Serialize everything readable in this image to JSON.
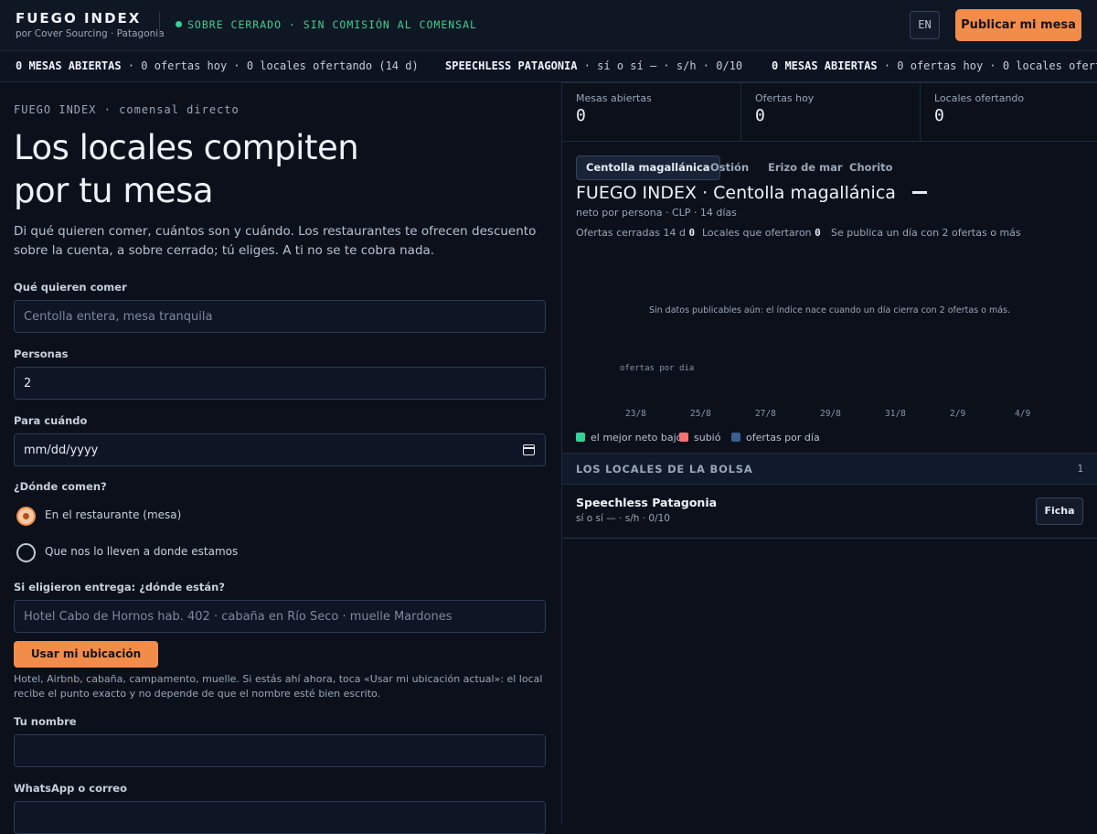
{
  "header": {
    "brand": "FUEGO INDEX",
    "brand_sub": "por Cover Sourcing · Patagonia",
    "status": "SOBRE CERRADO · SIN COMISIÓN AL COMENSAL",
    "lang_label": "EN",
    "publish_label": "Publicar mi mesa",
    "accent_color": "#f28c4a",
    "status_color": "#34d399"
  },
  "ticker": [
    {
      "bold": "0 MESAS ABIERTAS",
      "rest": " · 0 ofertas hoy · 0 locales ofertando (14 d)"
    },
    {
      "bold": "SPEECHLESS PATAGONIA",
      "rest": " · sí o sí — · s/h · 0/10"
    },
    {
      "bold": "0 MESAS ABIERTAS",
      "rest": " · 0 ofertas hoy · 0 locales ofertando (14 d)"
    }
  ],
  "form": {
    "eyebrow": "FUEGO INDEX · comensal directo",
    "hero_line1": "Los locales compiten",
    "hero_line2": "por tu mesa",
    "lead": "Di qué quieren comer, cuántos son y cuándo. Los restaurantes te ofrecen descuento sobre la cuenta, a sobre cerrado; tú eliges. A ti no se te cobra nada.",
    "what_label": "Qué quieren comer",
    "what_placeholder": "Centolla entera, mesa tranquila",
    "people_label": "Personas",
    "people_value": "2",
    "when_label": "Para cuándo",
    "when_value": "mm/dd/yyyy",
    "where_label": "¿Dónde comen?",
    "option_restaurant": "En el restaurante (mesa)",
    "option_delivery": "Que nos lo lleven a donde estamos",
    "selected_option": "En el restaurante (mesa)",
    "delivery_label": "Si eligieron entrega: ¿dónde están?",
    "delivery_placeholder": "Hotel Cabo de Hornos hab. 402 · cabaña en Río Seco · muelle Mardones",
    "location_button": "Usar mi ubicación actual",
    "hint": "Hotel, Airbnb, cabaña, campamento, muelle. Si estás ahí ahora, toca «Usar mi ubicación actual»: el local recibe el punto exacto y no depende de que el nombre esté bien escrito.",
    "name_label": "Tu nombre",
    "name_value": "",
    "contact_label": "WhatsApp o correo",
    "contact_value": ""
  },
  "stats": [
    {
      "label": "Mesas abiertas",
      "value": "0"
    },
    {
      "label": "Ofertas hoy",
      "value": "0"
    },
    {
      "label": "Locales ofertando",
      "value": "0"
    }
  ],
  "index": {
    "tabs": [
      "Centolla magallánica",
      "Ostión",
      "Erizo de mar",
      "Chorito"
    ],
    "active_tab": "Centolla magallánica",
    "title": "FUEGO INDEX · Centolla magallánica",
    "subtitle": "neto por persona · CLP · 14 días",
    "closed_label": "Ofertas cerradas 14 d",
    "closed_value": "0",
    "bidders_label": "Locales que ofertaron",
    "bidders_value": "0",
    "publish_rule": "Se publica un día con 2 ofertas o más"
  },
  "chart_data": {
    "type": "bar",
    "empty_message": "Sin datos publicables aún: el índice nace cuando un día cierra con 2 ofertas o más.",
    "ylabel": "ofertas por dia",
    "x_ticks": [
      "23/8",
      "25/8",
      "27/8",
      "29/8",
      "31/8",
      "2/9",
      "4/9"
    ],
    "series": [
      {
        "name": "el mejor neto bajó",
        "color": "#34d399",
        "values": []
      },
      {
        "name": "subió",
        "color": "#f87171",
        "values": []
      },
      {
        "name": "ofertas por día",
        "color": "#3b5f8f",
        "values": []
      }
    ]
  },
  "bolsa": {
    "title": "LOS LOCALES DE LA BOLSA",
    "count": "1",
    "locals": [
      {
        "name": "Speechless Patagonia",
        "meta": "sí o sí — · s/h · 0/10",
        "button": "Ficha"
      }
    ]
  }
}
